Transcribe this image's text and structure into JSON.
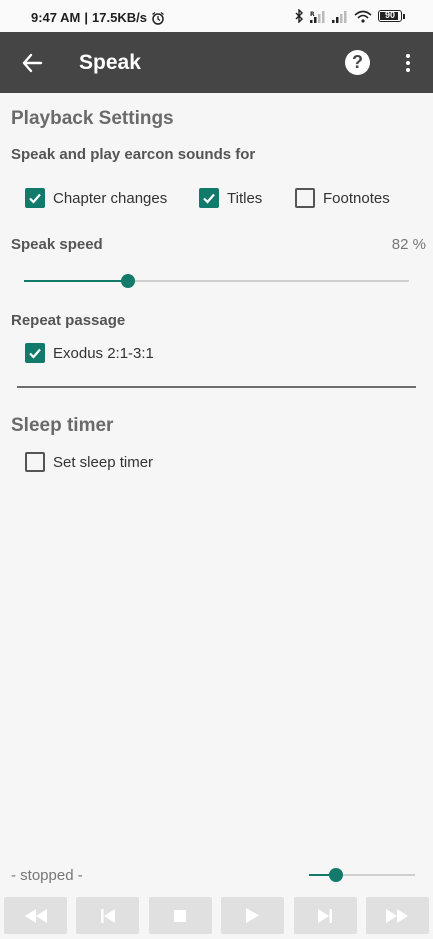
{
  "status_bar": {
    "time": "9:47 AM",
    "separator": "|",
    "speed": "17.5KB/s",
    "battery": "90"
  },
  "toolbar": {
    "title": "Speak"
  },
  "playback": {
    "title": "Playback Settings",
    "earcon_label": "Speak and play earcon sounds for",
    "options": [
      {
        "label": "Chapter changes",
        "checked": true
      },
      {
        "label": "Titles",
        "checked": true
      },
      {
        "label": "Footnotes",
        "checked": false
      }
    ],
    "speed_label": "Speak speed",
    "speed_value": "82 %",
    "speed_slider_fraction": 0.27,
    "repeat_label": "Repeat passage",
    "repeat_option": {
      "label": "Exodus 2:1-3:1",
      "checked": true
    }
  },
  "sleep": {
    "title": "Sleep timer",
    "option": {
      "label": "Set sleep timer",
      "checked": false
    }
  },
  "player": {
    "status": "- stopped -",
    "volume_fraction": 0.25
  },
  "icons": {
    "back": "arrow-left-icon",
    "help": "help-icon",
    "menu": "more-vertical-icon",
    "controls": [
      "rewind-icon",
      "skip-previous-icon",
      "stop-icon",
      "play-icon",
      "skip-next-icon",
      "fast-forward-icon"
    ]
  },
  "colors": {
    "accent": "#117a6b",
    "toolbar": "#454545",
    "background": "#f6f6f6"
  }
}
